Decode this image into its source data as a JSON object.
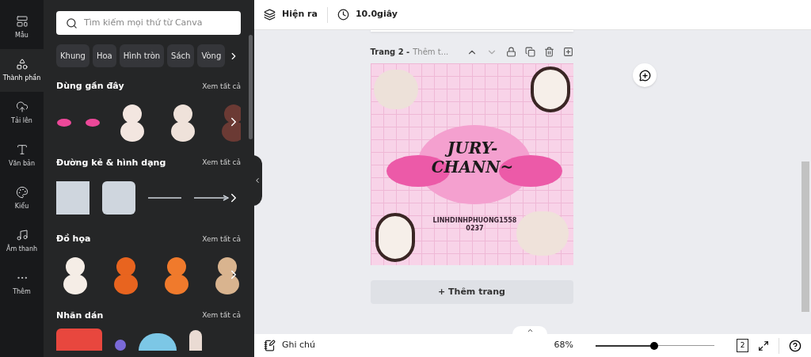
{
  "rail": [
    {
      "label": "Mẫu",
      "selected": false
    },
    {
      "label": "Thành phần",
      "selected": true
    },
    {
      "label": "Tải lên",
      "selected": false
    },
    {
      "label": "Văn bản",
      "selected": false
    },
    {
      "label": "Kiểu",
      "selected": false
    },
    {
      "label": "Âm thanh",
      "selected": false
    },
    {
      "label": "Thêm",
      "selected": false
    }
  ],
  "search": {
    "placeholder": "Tìm kiếm mọi thứ từ Canva"
  },
  "chips": [
    "Khung",
    "Hoa",
    "Hình tròn",
    "Sách",
    "Vòng"
  ],
  "sections": [
    {
      "title": "Dùng gần đây",
      "link": "Xem tất cả",
      "kind": "stickers"
    },
    {
      "title": "Đường kẻ & hình dạng",
      "link": "Xem tất cả",
      "kind": "shapes"
    },
    {
      "title": "Đồ họa",
      "link": "Xem tất cả",
      "kind": "animals"
    },
    {
      "title": "Nhãn dán",
      "link": "Xem tất cả",
      "kind": "labels"
    }
  ],
  "toolbar": {
    "animate": "Hiện ra",
    "duration": "10.0giây"
  },
  "page": {
    "label": "Trang 2 -",
    "title_placeholder": "Thêm t...",
    "design_title": [
      "JURY-",
      "CHANN~"
    ],
    "design_caption": [
      "LINHDINHPHUONG1558",
      "0237"
    ]
  },
  "add_page": "+ Thêm trang",
  "footer": {
    "notes": "Ghi chú",
    "zoom": "68%",
    "level": 0.49,
    "page_count": "2"
  }
}
